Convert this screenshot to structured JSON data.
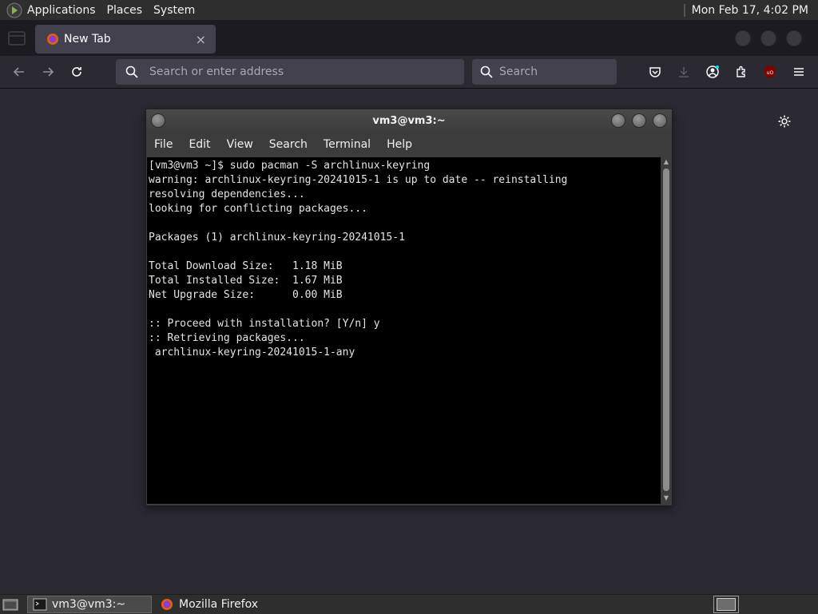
{
  "top_panel": {
    "menus": [
      "Applications",
      "Places",
      "System"
    ],
    "clock": "Mon Feb 17,  4:02 PM"
  },
  "browser": {
    "tab": {
      "title": "New Tab",
      "close": "×"
    },
    "urlbar": {
      "placeholder": "Search or enter address"
    },
    "searchbar": {
      "placeholder": "Search"
    }
  },
  "terminal": {
    "title": "vm3@vm3:~",
    "menus": [
      "File",
      "Edit",
      "View",
      "Search",
      "Terminal",
      "Help"
    ],
    "output": "[vm3@vm3 ~]$ sudo pacman -S archlinux-keyring\nwarning: archlinux-keyring-20241015-1 is up to date -- reinstalling\nresolving dependencies...\nlooking for conflicting packages...\n\nPackages (1) archlinux-keyring-20241015-1\n\nTotal Download Size:   1.18 MiB\nTotal Installed Size:  1.67 MiB\nNet Upgrade Size:      0.00 MiB\n\n:: Proceed with installation? [Y/n] y\n:: Retrieving packages...\n archlinux-keyring-20241015-1-any"
  },
  "taskbar": {
    "items": [
      {
        "label": "vm3@vm3:~",
        "icon": "terminal-icon",
        "active": true
      },
      {
        "label": "Mozilla Firefox",
        "icon": "firefox-icon",
        "active": false
      }
    ]
  }
}
